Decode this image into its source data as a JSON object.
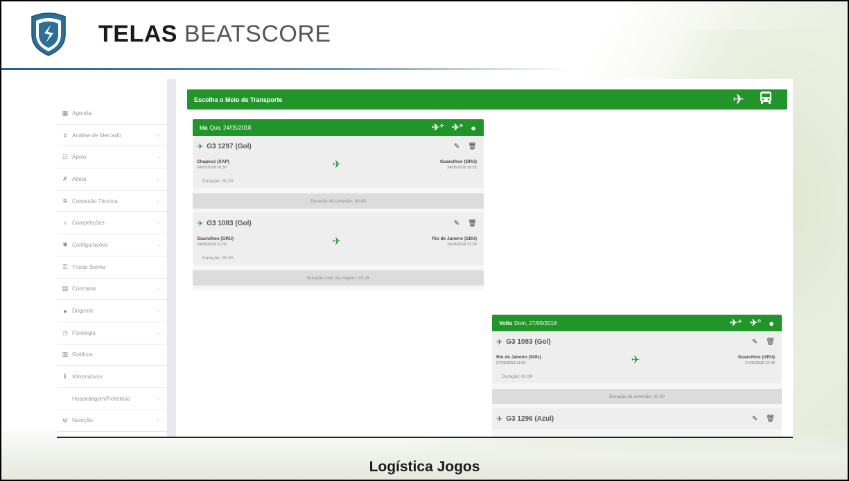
{
  "slide": {
    "title_bold": "TELAS",
    "title_rest": "BEATSCORE",
    "caption": "Logística Jogos"
  },
  "colors": {
    "green": "#22952a",
    "logo_blue": "#2d6e96"
  },
  "sidebar": {
    "items": [
      {
        "icon": "calendar-icon",
        "glyph": "▦",
        "label": "Agenda",
        "chevron": false
      },
      {
        "icon": "chart-icon",
        "glyph": "♯",
        "label": "Análise de Mercado",
        "chevron": true
      },
      {
        "icon": "users-icon",
        "glyph": "☷",
        "label": "Apoio",
        "chevron": true
      },
      {
        "icon": "athlete-icon",
        "glyph": "✗",
        "label": "Atleta",
        "chevron": true
      },
      {
        "icon": "gear-icon",
        "glyph": "✲",
        "label": "Comissão Técnica",
        "chevron": true
      },
      {
        "icon": "trophy-icon",
        "glyph": "♆",
        "label": "Competições",
        "chevron": true
      },
      {
        "icon": "settings-icon",
        "glyph": "✺",
        "label": "Configurações",
        "chevron": true
      },
      {
        "icon": "key-icon",
        "glyph": "⚿",
        "label": "Trocar Senha",
        "chevron": false
      },
      {
        "icon": "document-icon",
        "glyph": "▤",
        "label": "Contratos",
        "chevron": true
      },
      {
        "icon": "user-icon",
        "glyph": "●",
        "label": "Drigente",
        "chevron": true
      },
      {
        "icon": "clock-icon",
        "glyph": "◷",
        "label": "Fisiologia",
        "chevron": true
      },
      {
        "icon": "bar-chart-icon",
        "glyph": "▥",
        "label": "Gráficos",
        "chevron": false
      },
      {
        "icon": "info-icon",
        "glyph": "ℹ",
        "label": "Informativos",
        "chevron": false
      },
      {
        "icon": "",
        "glyph": "",
        "label": "Hospedagem/Refeitório",
        "chevron": true
      },
      {
        "icon": "cutlery-icon",
        "glyph": "Ψ",
        "label": "Nutrição",
        "chevron": true
      }
    ]
  },
  "main": {
    "transport_title": "Escolha o Meio de Transporte",
    "transport_buttons": [
      {
        "icon": "airplane-icon",
        "glyph": "✈"
      },
      {
        "icon": "bus-icon",
        "glyph": "🚌"
      }
    ],
    "outbound": {
      "label": "Ida",
      "date": "Qua, 24/05/2018",
      "header_buttons": [
        {
          "icon": "add-flight-icon",
          "glyph": "✈⁺"
        },
        {
          "icon": "add-flight-alt-icon",
          "glyph": "✈°"
        },
        {
          "icon": "passenger-icon",
          "glyph": "●"
        }
      ],
      "flights": [
        {
          "name": "G3 1297 (Gol)",
          "from_airport": "Chapecó (XAP)",
          "from_datetime": "24/05/2018 16:30",
          "to_airport": "Guarulhos (GRU)",
          "to_datetime": "24/05/2018 20:15",
          "duration": "Duração: 01:20",
          "footer": "Duração da conexão: 00:00"
        },
        {
          "name": "G3 1083 (Gol)",
          "from_airport": "Guarulhos (GRU)",
          "from_datetime": "24/05/2018 21:00",
          "to_airport": "Rio de Janeiro (SDU)",
          "to_datetime": "24/05/2018 22:00",
          "duration": "Duração: 01:00",
          "footer": "Duração total da viagem: 03:25"
        }
      ]
    },
    "return": {
      "label": "Volta",
      "date": "Dom, 27/05/2018",
      "header_buttons": [
        {
          "icon": "add-flight-icon",
          "glyph": "✈⁺"
        },
        {
          "icon": "add-flight-alt-icon",
          "glyph": "✈°"
        },
        {
          "icon": "passenger-icon",
          "glyph": "●"
        }
      ],
      "flights": [
        {
          "name": "G3 1083 (Gol)",
          "from_airport": "Rio de Janeiro (SDU)",
          "from_datetime": "27/05/2018 11:00",
          "to_airport": "Guarulhos (GRU)",
          "to_datetime": "27/05/2018 12:00",
          "duration": "Duração: 01:00",
          "footer": "Duração da conexão: 00:00"
        },
        {
          "name": "G3 1296 (Azul)"
        }
      ]
    }
  }
}
